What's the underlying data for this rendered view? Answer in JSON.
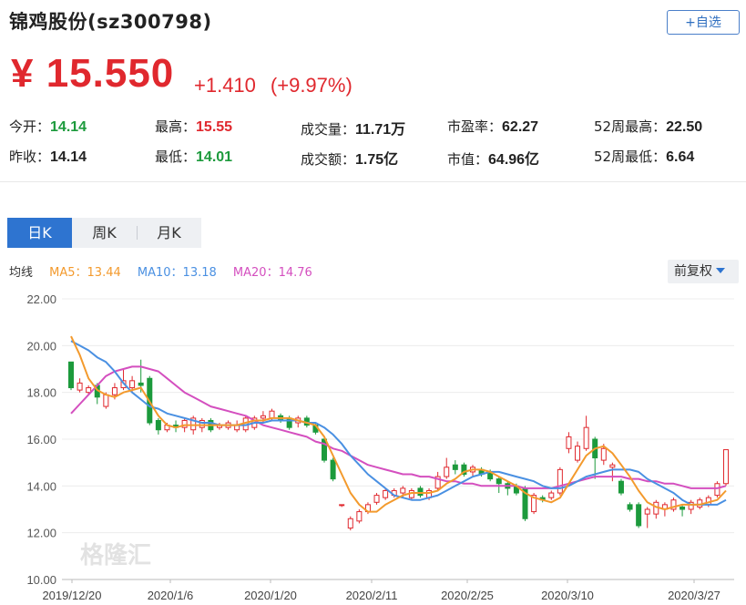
{
  "header": {
    "title": "锦鸡股份(sz300798)",
    "add_watchlist_label": "+自选",
    "price": "¥ 15.550",
    "change": "+1.410",
    "change_pct": "(+9.97%)"
  },
  "stats": [
    {
      "label": "今开：",
      "value": "14.14",
      "tone": "dn"
    },
    {
      "label": "最高：",
      "value": "15.55",
      "tone": "up"
    },
    {
      "label": "成交量：",
      "value": "11.71万",
      "tone": "nt"
    },
    {
      "label": "市盈率：",
      "value": "62.27",
      "tone": "nt"
    },
    {
      "label": "52周最高：",
      "value": "22.50",
      "tone": "nt"
    },
    {
      "label": "昨收：",
      "value": "14.14",
      "tone": "nt"
    },
    {
      "label": "最低：",
      "value": "14.01",
      "tone": "dn"
    },
    {
      "label": "成交额：",
      "value": "1.75亿",
      "tone": "nt"
    },
    {
      "label": "市值：",
      "value": "64.96亿",
      "tone": "nt"
    },
    {
      "label": "52周最低：",
      "value": "6.64",
      "tone": "nt"
    }
  ],
  "tabs": [
    {
      "label": "日K",
      "active": true
    },
    {
      "label": "周K",
      "active": false
    },
    {
      "label": "月K",
      "active": false
    }
  ],
  "ma_legend": {
    "prefix": "均线",
    "ma5": "MA5：13.44",
    "ma10": "MA10：13.18",
    "ma20": "MA20：14.76"
  },
  "adjust_label": "前复权",
  "watermark": "格隆汇",
  "colors": {
    "up": "#e0282e",
    "down": "#1c9a3c",
    "ma5": "#f39a2d",
    "ma10": "#4a90e2",
    "ma20": "#d44fbf",
    "accent": "#2e74d0"
  },
  "chart_data": {
    "type": "candlestick",
    "ylim": [
      10,
      22
    ],
    "yticks": [
      "22.00",
      "20.00",
      "18.00",
      "16.00",
      "14.00",
      "12.00",
      "10.00"
    ],
    "xticks": [
      "2019/12/20",
      "2020/1/6",
      "2020/1/20",
      "2020/2/11",
      "2020/2/25",
      "2020/3/10",
      "2020/3/27"
    ],
    "candles": [
      [
        19.3,
        18.2,
        19.3,
        18.1
      ],
      [
        18.1,
        18.4,
        18.6,
        18.0
      ],
      [
        18.0,
        18.2,
        18.3,
        17.9
      ],
      [
        18.3,
        17.8,
        18.4,
        17.5
      ],
      [
        17.4,
        17.9,
        18.0,
        17.3
      ],
      [
        17.9,
        18.2,
        18.4,
        17.7
      ],
      [
        18.2,
        18.5,
        19.0,
        18.1
      ],
      [
        18.2,
        18.5,
        18.7,
        18.0
      ],
      [
        18.4,
        18.3,
        19.4,
        18.0
      ],
      [
        18.6,
        16.7,
        18.7,
        16.6
      ],
      [
        16.8,
        16.4,
        16.9,
        16.2
      ],
      [
        16.4,
        16.6,
        16.7,
        16.3
      ],
      [
        16.6,
        16.5,
        16.8,
        16.3
      ],
      [
        16.5,
        16.8,
        16.9,
        16.3
      ],
      [
        16.4,
        16.9,
        17.0,
        16.2
      ],
      [
        16.5,
        16.8,
        16.9,
        16.3
      ],
      [
        16.8,
        16.4,
        16.9,
        16.3
      ],
      [
        16.5,
        16.6,
        16.7,
        16.4
      ],
      [
        16.5,
        16.7,
        16.8,
        16.4
      ],
      [
        16.4,
        16.6,
        16.8,
        16.3
      ],
      [
        16.4,
        16.9,
        17.0,
        16.3
      ],
      [
        16.5,
        16.9,
        17.0,
        16.4
      ],
      [
        16.9,
        17.0,
        17.2,
        16.7
      ],
      [
        16.9,
        17.2,
        17.3,
        16.8
      ],
      [
        17.0,
        16.8,
        17.1,
        16.7
      ],
      [
        16.9,
        16.5,
        17.0,
        16.4
      ],
      [
        16.7,
        16.9,
        17.0,
        16.5
      ],
      [
        16.9,
        16.6,
        17.0,
        16.5
      ],
      [
        16.6,
        16.3,
        16.7,
        16.2
      ],
      [
        16.0,
        15.1,
        16.1,
        15.0
      ],
      [
        15.1,
        14.3,
        15.2,
        14.2
      ],
      [
        13.2,
        13.2,
        13.2,
        13.1
      ],
      [
        12.2,
        12.6,
        12.7,
        12.1
      ],
      [
        12.5,
        12.9,
        13.0,
        12.4
      ],
      [
        12.9,
        13.2,
        13.3,
        12.8
      ],
      [
        13.3,
        13.6,
        13.7,
        13.2
      ],
      [
        13.5,
        13.8,
        13.9,
        13.4
      ],
      [
        13.6,
        13.8,
        13.9,
        13.5
      ],
      [
        13.7,
        13.9,
        14.0,
        13.5
      ],
      [
        13.5,
        13.8,
        13.9,
        13.4
      ],
      [
        13.9,
        13.6,
        14.0,
        13.5
      ],
      [
        13.5,
        13.8,
        13.9,
        13.4
      ],
      [
        13.9,
        14.4,
        14.6,
        13.8
      ],
      [
        14.4,
        14.8,
        15.2,
        14.3
      ],
      [
        14.9,
        14.7,
        15.1,
        14.5
      ],
      [
        14.9,
        14.5,
        15.0,
        14.4
      ],
      [
        14.6,
        14.8,
        14.9,
        14.4
      ],
      [
        14.7,
        14.5,
        14.8,
        14.4
      ],
      [
        14.6,
        14.3,
        14.7,
        14.2
      ],
      [
        14.3,
        14.1,
        14.4,
        13.7
      ],
      [
        14.1,
        13.9,
        14.2,
        13.6
      ],
      [
        14.0,
        13.7,
        14.1,
        13.6
      ],
      [
        13.9,
        12.6,
        14.0,
        12.5
      ],
      [
        12.9,
        13.6,
        13.7,
        12.8
      ],
      [
        13.5,
        13.4,
        13.6,
        13.3
      ],
      [
        13.5,
        13.7,
        13.8,
        13.4
      ],
      [
        13.7,
        14.7,
        14.8,
        13.6
      ],
      [
        15.6,
        16.1,
        16.3,
        15.4
      ],
      [
        15.1,
        15.7,
        15.9,
        15.0
      ],
      [
        15.6,
        16.5,
        17.0,
        15.5
      ],
      [
        16.0,
        15.2,
        16.1,
        14.3
      ],
      [
        15.1,
        15.6,
        15.8,
        14.9
      ],
      [
        14.8,
        14.9,
        15.0,
        14.2
      ],
      [
        14.2,
        13.7,
        14.3,
        13.6
      ],
      [
        13.2,
        13.0,
        13.3,
        12.9
      ],
      [
        13.2,
        12.3,
        13.3,
        12.2
      ],
      [
        12.8,
        13.0,
        13.1,
        12.2
      ],
      [
        12.8,
        13.3,
        13.4,
        12.6
      ],
      [
        13.0,
        13.2,
        13.3,
        12.7
      ],
      [
        13.0,
        13.4,
        13.5,
        12.9
      ],
      [
        13.1,
        13.0,
        13.2,
        12.7
      ],
      [
        13.0,
        13.3,
        13.4,
        12.8
      ],
      [
        13.1,
        13.4,
        13.5,
        13.0
      ],
      [
        13.2,
        13.5,
        13.6,
        13.1
      ],
      [
        13.6,
        14.1,
        14.2,
        13.5
      ],
      [
        14.1,
        15.55,
        15.55,
        14.01
      ]
    ],
    "ma5": [
      20.4,
      19.6,
      18.6,
      18.1,
      17.9,
      17.8,
      18.0,
      18.1,
      18.2,
      17.6,
      17.0,
      16.6,
      16.5,
      16.6,
      16.6,
      16.6,
      16.6,
      16.6,
      16.6,
      16.6,
      16.7,
      16.8,
      16.8,
      16.9,
      16.9,
      16.9,
      16.8,
      16.7,
      16.6,
      16.1,
      15.3,
      14.5,
      13.7,
      13.2,
      12.9,
      12.9,
      13.2,
      13.4,
      13.6,
      13.7,
      13.7,
      13.7,
      13.8,
      14.1,
      14.3,
      14.6,
      14.7,
      14.7,
      14.6,
      14.4,
      14.2,
      14.0,
      13.7,
      13.5,
      13.4,
      13.3,
      13.5,
      14.1,
      14.7,
      15.3,
      15.6,
      15.7,
      15.4,
      14.9,
      14.4,
      13.8,
      13.3,
      13.1,
      13.0,
      13.1,
      13.2,
      13.2,
      13.2,
      13.3,
      13.4,
      13.8
    ],
    "ma10": [
      20.2,
      20.0,
      19.8,
      19.5,
      19.3,
      18.9,
      18.4,
      18.0,
      17.7,
      17.4,
      17.3,
      17.1,
      17.0,
      16.9,
      16.8,
      16.7,
      16.7,
      16.6,
      16.6,
      16.6,
      16.6,
      16.7,
      16.7,
      16.8,
      16.8,
      16.8,
      16.8,
      16.7,
      16.7,
      16.5,
      16.2,
      15.8,
      15.3,
      14.9,
      14.5,
      14.2,
      13.9,
      13.6,
      13.5,
      13.4,
      13.4,
      13.5,
      13.6,
      13.8,
      14.0,
      14.2,
      14.4,
      14.5,
      14.6,
      14.6,
      14.5,
      14.4,
      14.3,
      14.2,
      14.0,
      13.9,
      13.9,
      14.0,
      14.2,
      14.4,
      14.5,
      14.6,
      14.7,
      14.7,
      14.7,
      14.6,
      14.3,
      14.1,
      13.9,
      13.7,
      13.4,
      13.2,
      13.2,
      13.2,
      13.2,
      13.4
    ],
    "ma20": [
      17.1,
      17.5,
      17.9,
      18.3,
      18.7,
      18.9,
      19.0,
      19.1,
      19.1,
      19.0,
      18.9,
      18.6,
      18.3,
      18.0,
      17.8,
      17.6,
      17.4,
      17.3,
      17.2,
      17.1,
      17.0,
      16.8,
      16.6,
      16.5,
      16.4,
      16.3,
      16.2,
      16.1,
      15.9,
      15.8,
      15.6,
      15.5,
      15.3,
      15.1,
      14.9,
      14.8,
      14.7,
      14.6,
      14.5,
      14.5,
      14.4,
      14.4,
      14.3,
      14.2,
      14.2,
      14.1,
      14.1,
      14.0,
      14.0,
      14.0,
      14.0,
      14.0,
      13.9,
      13.9,
      13.9,
      13.9,
      14.0,
      14.1,
      14.2,
      14.3,
      14.4,
      14.4,
      14.4,
      14.4,
      14.3,
      14.3,
      14.2,
      14.2,
      14.1,
      14.1,
      14.0,
      13.9,
      13.9,
      13.9,
      13.9,
      14.0
    ]
  }
}
